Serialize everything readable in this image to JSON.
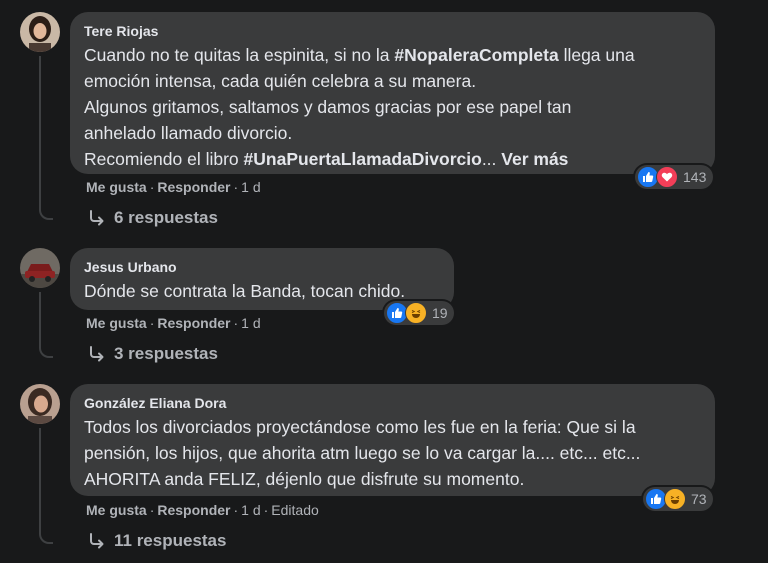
{
  "comments": [
    {
      "author": "Tere Riojas",
      "lines": [
        {
          "pre": "Cuando no te quitas la espinita, si no la ",
          "tag": "#NopaleraCompleta",
          "post": " llega una"
        },
        {
          "pre": "emoción intensa, cada quién celebra a su manera.",
          "tag": "",
          "post": ""
        },
        {
          "pre": "Algunos gritamos, saltamos y damos gracias por ese papel tan",
          "tag": "",
          "post": ""
        },
        {
          "pre": "anhelado llamado divorcio.",
          "tag": "",
          "post": ""
        },
        {
          "pre": "Recomiendo el libro ",
          "tag": "#UnaPuertaLlamadaDivorcio",
          "post": "... "
        }
      ],
      "see_more": "Ver más",
      "like_label": "Me gusta",
      "reply_label": "Responder",
      "time": "1 d",
      "reaction_count": "143",
      "replies_label": "6 respuestas"
    },
    {
      "author": "Jesus Urbano",
      "text": "Dónde se contrata la Banda, tocan chido.",
      "like_label": "Me gusta",
      "reply_label": "Responder",
      "time": "1 d",
      "reaction_count": "19",
      "replies_label": "3 respuestas"
    },
    {
      "author": "González Eliana Dora",
      "lines": [
        "Todos los divorciados proyectándose como les fue en la feria: Que si la",
        "pensión, los hijos, que ahorita atm luego se lo va cargar la.... etc... etc...",
        "AHORITA anda FELIZ, déjenlo que disfrute su momento."
      ],
      "like_label": "Me gusta",
      "reply_label": "Responder",
      "time": "1 d",
      "edited": "Editado",
      "reaction_count": "73",
      "replies_label": "11 respuestas"
    }
  ],
  "icons": {
    "reaction_a": "like-icon",
    "reaction_b": "love-icon",
    "reaction_c": "haha-icon",
    "replies": "reply-arrow-icon"
  },
  "colors": {
    "background": "#18191a",
    "bubble": "#3a3b3c",
    "text": "#e4e6eb",
    "secondary": "#b0b3b8",
    "like": "#1877f2",
    "love": "#f33e58",
    "haha": "#f7b125"
  }
}
